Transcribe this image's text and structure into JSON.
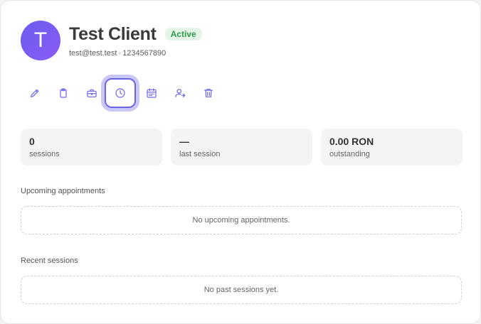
{
  "client": {
    "initial": "T",
    "name": "Test Client",
    "status": "Active",
    "email": "test@test.test",
    "separator": "·",
    "phone": "1234567890"
  },
  "toolbar": {
    "items": [
      {
        "icon": "pencil-icon",
        "label": "edit"
      },
      {
        "icon": "clipboard-icon",
        "label": "notes"
      },
      {
        "icon": "briefcase-icon",
        "label": "briefcase"
      },
      {
        "icon": "clock-icon",
        "label": "history",
        "active": true
      },
      {
        "icon": "calendar-icon",
        "label": "schedule"
      },
      {
        "icon": "user-arrow-icon",
        "label": "transfer client"
      },
      {
        "icon": "trash-icon",
        "label": "delete"
      }
    ]
  },
  "stats": [
    {
      "value": "0",
      "label": "sessions"
    },
    {
      "value": "—",
      "label": "last session"
    },
    {
      "value": "0.00 RON",
      "label": "outstanding"
    }
  ],
  "upcoming": {
    "title": "Upcoming appointments",
    "empty_text": "No upcoming appointments."
  },
  "recent": {
    "title": "Recent sessions",
    "empty_text": "No past sessions yet."
  },
  "colors": {
    "accent": "#6a63e8",
    "avatar": "#7a5cf3",
    "status_bg": "#e5f6e9",
    "status_text": "#2f9a48"
  }
}
